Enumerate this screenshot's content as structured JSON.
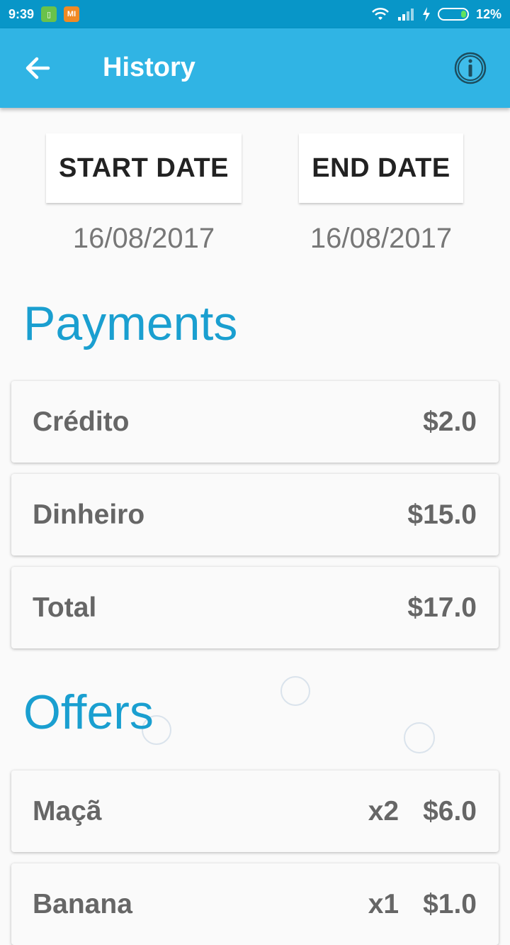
{
  "status_bar": {
    "time": "9:39",
    "battery_percent": "12%"
  },
  "toolbar": {
    "title": "History"
  },
  "dates": {
    "start_label": "START DATE",
    "end_label": "END DATE",
    "start_value": "16/08/2017",
    "end_value": "16/08/2017"
  },
  "payments": {
    "title": "Payments",
    "rows": [
      {
        "label": "Crédito",
        "amount": "$2.0"
      },
      {
        "label": "Dinheiro",
        "amount": "$15.0"
      },
      {
        "label": "Total",
        "amount": "$17.0"
      }
    ]
  },
  "offers": {
    "title": "Offers",
    "rows": [
      {
        "label": "Maçã",
        "qty": "x2",
        "amount": "$6.0"
      },
      {
        "label": "Banana",
        "qty": "x1",
        "amount": "$1.0"
      }
    ]
  },
  "colors": {
    "primary": "#30b4e4",
    "status_bar": "#0896c8",
    "accent_text": "#1a9fd0"
  }
}
